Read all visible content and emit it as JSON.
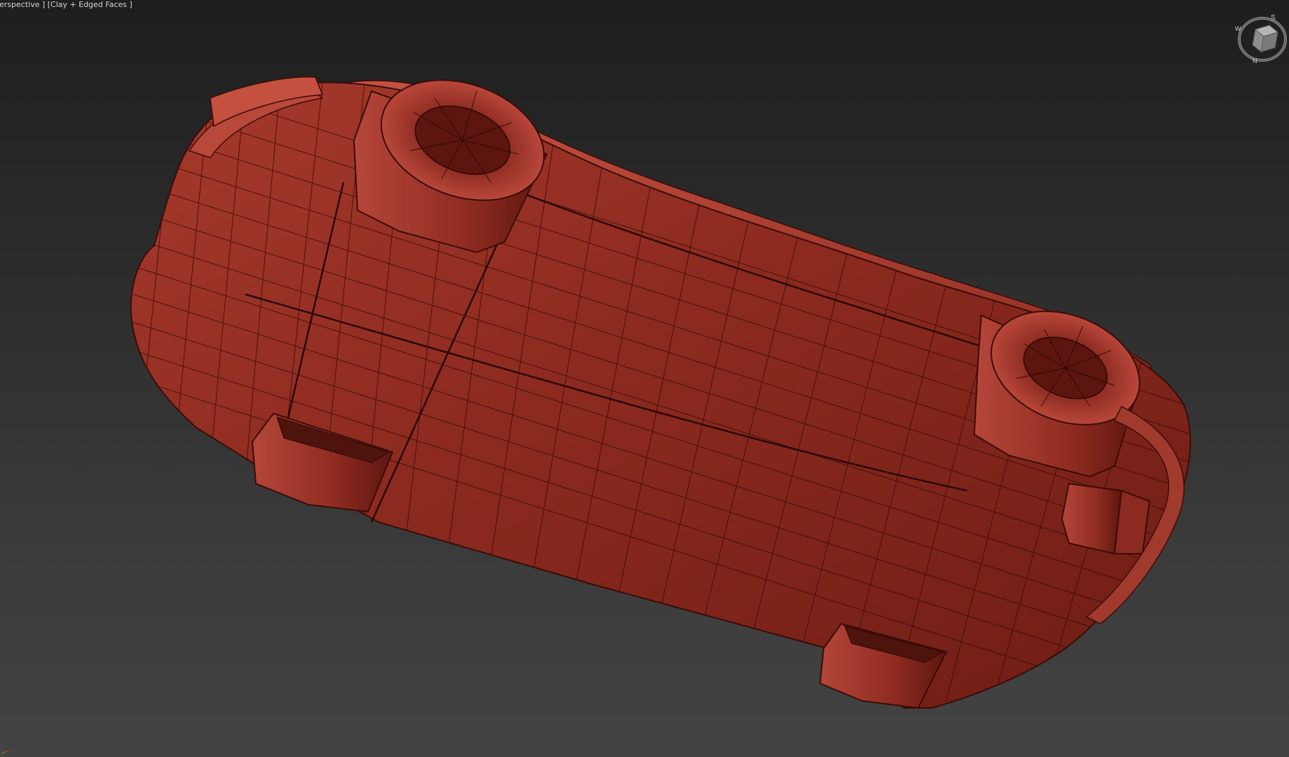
{
  "viewport": {
    "label": "erspective ] [Clay + Edged Faces ]",
    "background_top": "#1e1e1e",
    "background_bottom": "#434343"
  },
  "model": {
    "clay_color": "#8a2a20",
    "clay_dark": "#5e1812",
    "clay_light": "#b8483a",
    "edge_color": "#3a0c08"
  },
  "viewcube": {
    "compass_letters": [
      "S",
      "W",
      "N"
    ]
  },
  "icons": {
    "viewcube": "viewcube-navigation-icon",
    "axis": "axis-tripod-icon"
  }
}
